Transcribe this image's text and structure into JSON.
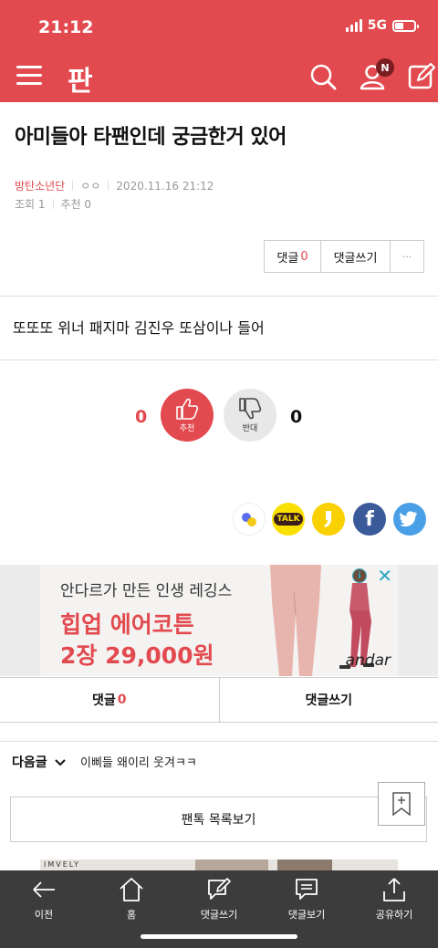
{
  "status_bar": {
    "time": "21:12",
    "network": "5G"
  },
  "header": {
    "logo_text": "판",
    "notification_badge": "N",
    "brand_color": "#e24a4f"
  },
  "article": {
    "title": "아미들아 타팬인데 궁금한거 있어",
    "author": "방탄소년단",
    "nick": "ㅇㅇ",
    "date": "2020.11.16 21:12",
    "views_label": "조회 1",
    "recommend_label": "추천 0",
    "body": "또또또 위너 패지마 김진우 또삼이나 들어"
  },
  "actions": {
    "comment_label": "댓글",
    "comment_count": "0",
    "write_label": "댓글쓰기",
    "more_label": "···"
  },
  "vote": {
    "up_count": "0",
    "up_label": "추천",
    "down_count": "0",
    "down_label": "반대"
  },
  "share": [
    {
      "icon": "share-dots-icon"
    },
    {
      "icon": "kakaotalk-icon",
      "text": "TALK"
    },
    {
      "icon": "kakaostory-icon"
    },
    {
      "icon": "facebook-icon",
      "text": "f"
    },
    {
      "icon": "twitter-icon"
    }
  ],
  "ad": {
    "line1": "안다르가 만든 인생 레깅스",
    "line2": "힙업 에어코튼",
    "line3": "2장 29,000원",
    "brand": "andar",
    "info_icon": "i",
    "close_icon": "✕"
  },
  "tabs": {
    "comment_label": "댓글",
    "comment_count": "0",
    "write_label": "댓글쓰기"
  },
  "next": {
    "label": "다음글",
    "title": "이삐들 왜이리 웃겨ㅋㅋ"
  },
  "list_button": "팬톡 목록보기",
  "peek_text": "IMVELY",
  "bottom_nav": [
    {
      "label": "이전",
      "icon": "back-arrow-icon"
    },
    {
      "label": "홈",
      "icon": "home-icon"
    },
    {
      "label": "댓글쓰기",
      "icon": "write-comment-icon"
    },
    {
      "label": "댓글보기",
      "icon": "view-comments-icon"
    },
    {
      "label": "공유하기",
      "icon": "share-icon"
    }
  ]
}
